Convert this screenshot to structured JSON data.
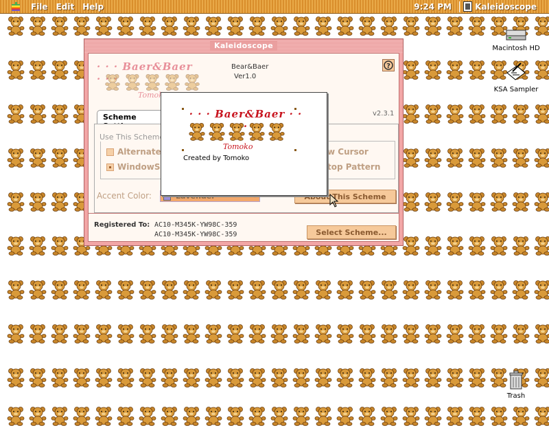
{
  "menubar": {
    "menus": [
      "File",
      "Edit",
      "Help"
    ],
    "clock": "9:24 PM",
    "app_name": "Kaleidoscope"
  },
  "desktop_icons": {
    "hd": "Macintosh HD",
    "ksa": "KSA Sampler",
    "trash": "Trash"
  },
  "window": {
    "title": "Kaleidoscope",
    "scheme_name": "Bear&Baer",
    "scheme_version": "Ver1.0",
    "logo_text": "Baer&Baer",
    "logo_signature": "Tomoko",
    "app_version": "v2.3.1",
    "tab_label": "Scheme Settings",
    "group_label": "Use This Scheme",
    "options": [
      "Alternate",
      "WindowShade",
      "w Cursor",
      "top Pattern"
    ],
    "accent_label": "Accent Color:",
    "accent_value": "Lavender",
    "about_button": "About This Scheme",
    "registered_label": "Registered To:",
    "registered_line1": "AC10-M345K-YW98C-359",
    "registered_line2": "AC10-M345K-YW98C-359",
    "select_button": "Select Scheme..."
  },
  "about": {
    "logo_text": "Baer&Baer",
    "signature": "Tomoko",
    "credit": "Created by Tomoko"
  }
}
